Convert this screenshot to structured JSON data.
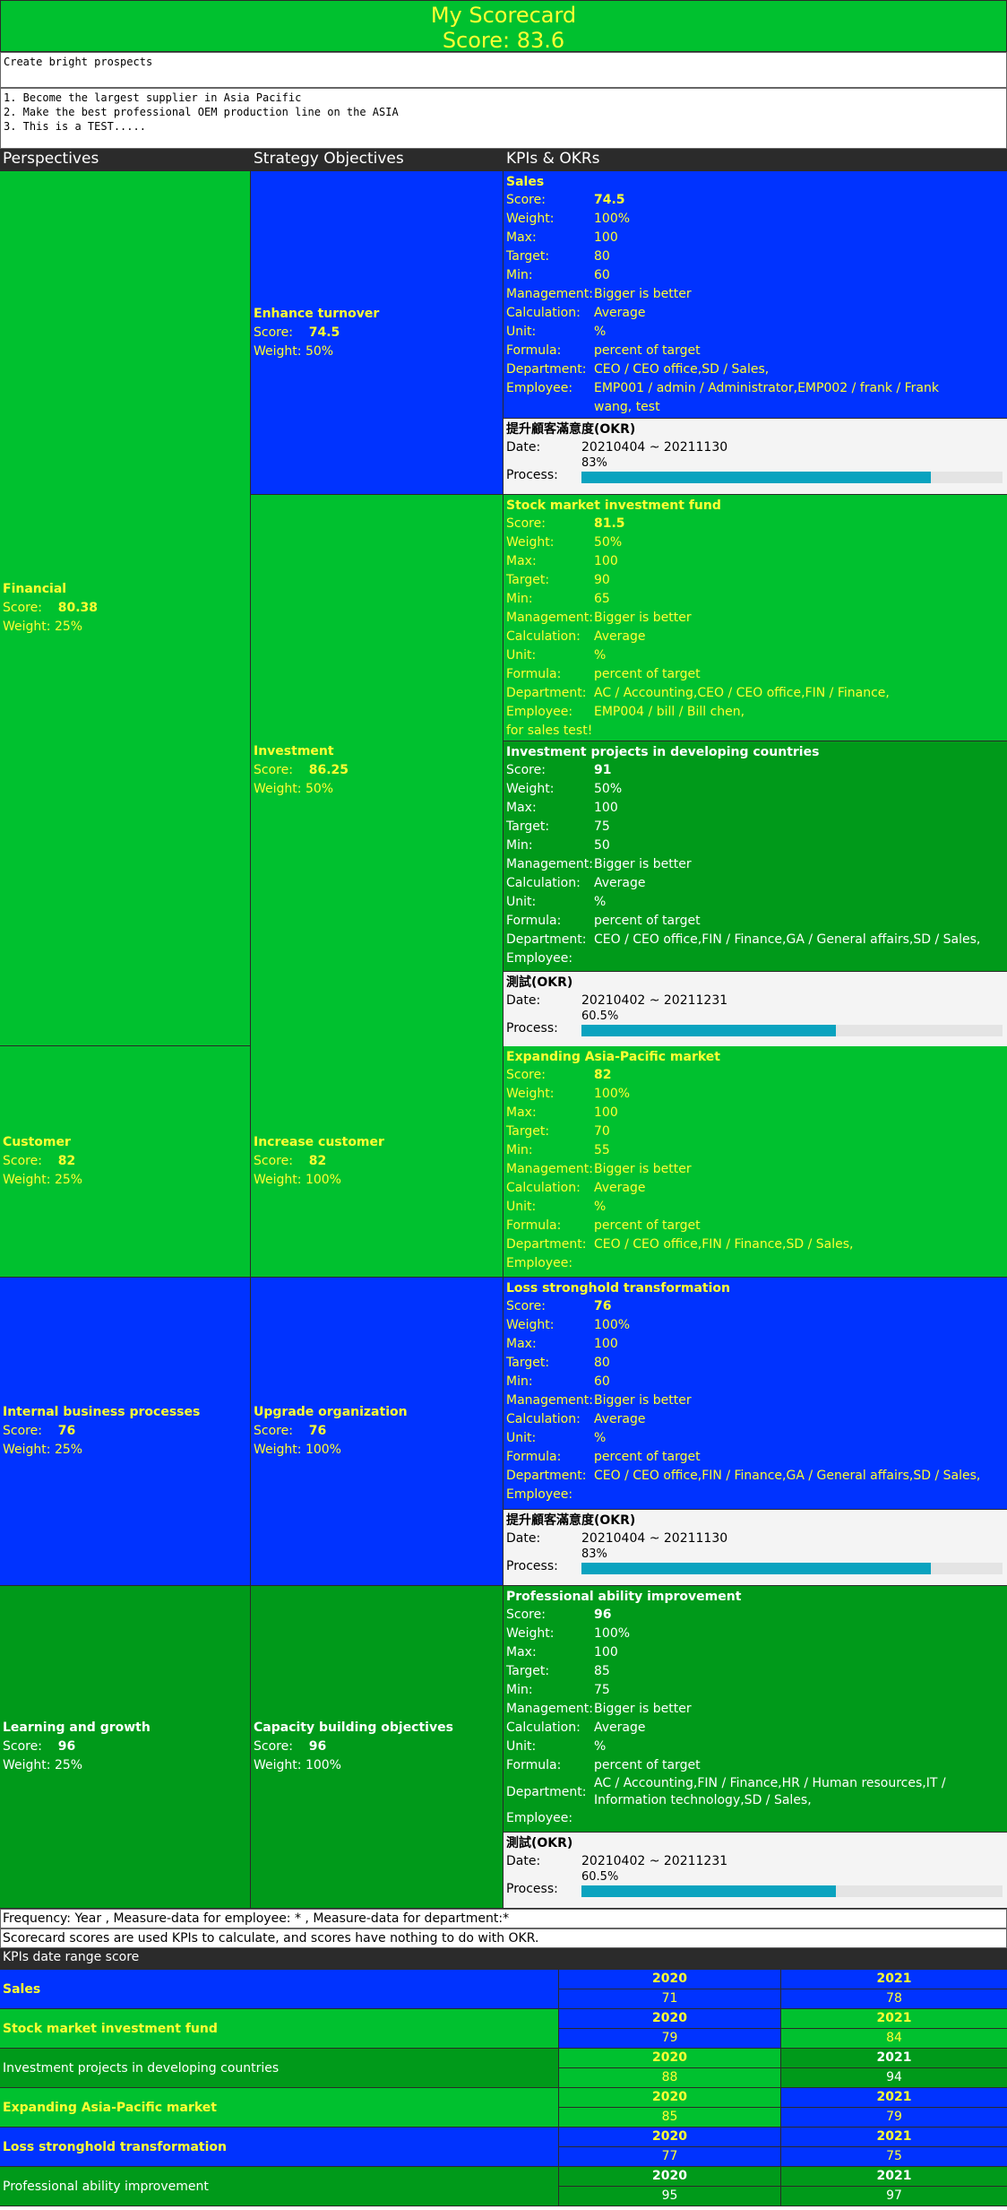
{
  "header": {
    "title": "My Scorecard",
    "score_line": "Score: 83.6"
  },
  "slogan": "Create bright prospects",
  "goals": "1. Become the largest supplier in Asia Pacific\n2. Make the best professional OEM production line on the ASIA\n3. This is a TEST.....",
  "columns": {
    "perspectives": "Perspectives",
    "objectives": "Strategy Objectives",
    "kpis": "KPIs & OKRs"
  },
  "labels": {
    "score": "Score:",
    "weight": "Weight:",
    "max": "Max:",
    "target": "Target:",
    "min": "Min:",
    "management": "Management:",
    "calculation": "Calculation:",
    "unit": "Unit:",
    "formula": "Formula:",
    "department": "Department:",
    "employee": "Employee:",
    "date": "Date:",
    "process": "Process:"
  },
  "perspectives": [
    {
      "name": "Financial",
      "score": "80.38",
      "weight": "Weight: 25%",
      "objectives": [
        {
          "name": "Enhance turnover",
          "score": "74.5",
          "weight": "Weight: 50%",
          "kpis": [
            {
              "title": "Sales",
              "score": "74.5",
              "weight": "100%",
              "max": "100",
              "target": "80",
              "min": "60",
              "management": "Bigger is better",
              "calculation": "Average",
              "unit": "%",
              "formula": "percent of target",
              "department": "CEO / CEO office,SD / Sales,",
              "employee": "EMP001 / admin / Administrator,EMP002 / frank / Frank wang, test"
            },
            {
              "okr": true,
              "title": "提升顧客滿意度(OKR)",
              "date": "20210404 ~ 20211130",
              "process": "83%",
              "progress": 0.83
            }
          ]
        },
        {
          "name": "Investment",
          "score": "86.25",
          "weight": "Weight: 50%",
          "kpis": [
            {
              "title": "Stock market investment fund",
              "score": "81.5",
              "weight": "50%",
              "max": "100",
              "target": "90",
              "min": "65",
              "management": "Bigger is better",
              "calculation": "Average",
              "unit": "%",
              "formula": "percent of target",
              "department": "AC / Accounting,CEO / CEO office,FIN / Finance,",
              "employee": "EMP004 / bill / Bill chen,",
              "extra": "for sales test!"
            },
            {
              "title": "Investment projects in developing countries",
              "score": "91",
              "weight": "50%",
              "max": "100",
              "target": "75",
              "min": "50",
              "management": "Bigger is better",
              "calculation": "Average",
              "unit": "%",
              "formula": "percent of target",
              "department": "CEO / CEO office,FIN / Finance,GA / General affairs,SD / Sales,",
              "employee": ""
            },
            {
              "okr": true,
              "title": "測試(OKR)",
              "date": "20210402 ~ 20211231",
              "process": "60.5%",
              "progress": 0.605
            }
          ]
        }
      ]
    },
    {
      "name": "Customer",
      "score": "82",
      "weight": "Weight: 25%",
      "objectives": [
        {
          "name": "Increase customer",
          "score": "82",
          "weight": "Weight: 100%",
          "kpis": [
            {
              "title": "Expanding Asia-Pacific market",
              "score": "82",
              "weight": "100%",
              "max": "100",
              "target": "70",
              "min": "55",
              "management": "Bigger is better",
              "calculation": "Average",
              "unit": "%",
              "formula": "percent of target",
              "department": "CEO / CEO office,FIN / Finance,SD / Sales,",
              "employee": ""
            }
          ]
        }
      ]
    },
    {
      "name": "Internal business processes",
      "score": "76",
      "weight": "Weight: 25%",
      "objectives": [
        {
          "name": "Upgrade organization",
          "score": "76",
          "weight": "Weight: 100%",
          "kpis": [
            {
              "title": "Loss stronghold transformation",
              "score": "76",
              "weight": "100%",
              "max": "100",
              "target": "80",
              "min": "60",
              "management": "Bigger is better",
              "calculation": "Average",
              "unit": "%",
              "formula": "percent of target",
              "department": "CEO / CEO office,FIN / Finance,GA / General affairs,SD / Sales,",
              "employee": ""
            },
            {
              "okr": true,
              "title": "提升顧客滿意度(OKR)",
              "date": "20210404 ~ 20211130",
              "process": "83%",
              "progress": 0.83
            }
          ]
        }
      ]
    },
    {
      "name": "Learning and growth",
      "score": "96",
      "weight": "Weight: 25%",
      "objectives": [
        {
          "name": "Capacity building objectives",
          "score": "96",
          "weight": "Weight: 100%",
          "kpis": [
            {
              "title": "Professional ability improvement",
              "score": "96",
              "weight": "100%",
              "max": "100",
              "target": "85",
              "min": "75",
              "management": "Bigger is better",
              "calculation": "Average",
              "unit": "%",
              "formula": "percent of target",
              "department": "AC / Accounting,FIN / Finance,HR / Human resources,IT / Information technology,SD / Sales,",
              "employee": ""
            },
            {
              "okr": true,
              "title": "測試(OKR)",
              "date": "20210402 ~ 20211231",
              "process": "60.5%",
              "progress": 0.605
            }
          ]
        }
      ]
    }
  ],
  "footer": {
    "frequency": "Frequency:  Year , Measure-data for employee: * , Measure-data for department:*",
    "note": "Scorecard scores are used KPIs to calculate, and scores have nothing to do with OKR."
  },
  "trend": {
    "title": "KPIs date range score",
    "rows": [
      {
        "name": "Sales",
        "years": [
          "2020",
          "2021"
        ],
        "values": [
          "71",
          "78"
        ]
      },
      {
        "name": "Stock market investment fund",
        "years": [
          "2020",
          "2021"
        ],
        "values": [
          "79",
          "84"
        ]
      },
      {
        "name": "Investment projects in developing countries",
        "years": [
          "2020",
          "2021"
        ],
        "values": [
          "88",
          "94"
        ]
      },
      {
        "name": "Expanding Asia-Pacific market",
        "years": [
          "2020",
          "2021"
        ],
        "values": [
          "85",
          "79"
        ]
      },
      {
        "name": "Loss stronghold transformation",
        "years": [
          "2020",
          "2021"
        ],
        "values": [
          "77",
          "75"
        ]
      },
      {
        "name": "Professional ability improvement",
        "years": [
          "2020",
          "2021"
        ],
        "values": [
          "95",
          "97"
        ]
      }
    ]
  },
  "colors": {
    "blue": "#0033ff",
    "green": "#00c12f",
    "dark_green": "#009a1a",
    "yellow_text": "#ffff33",
    "progress": "#0aa3bf"
  }
}
